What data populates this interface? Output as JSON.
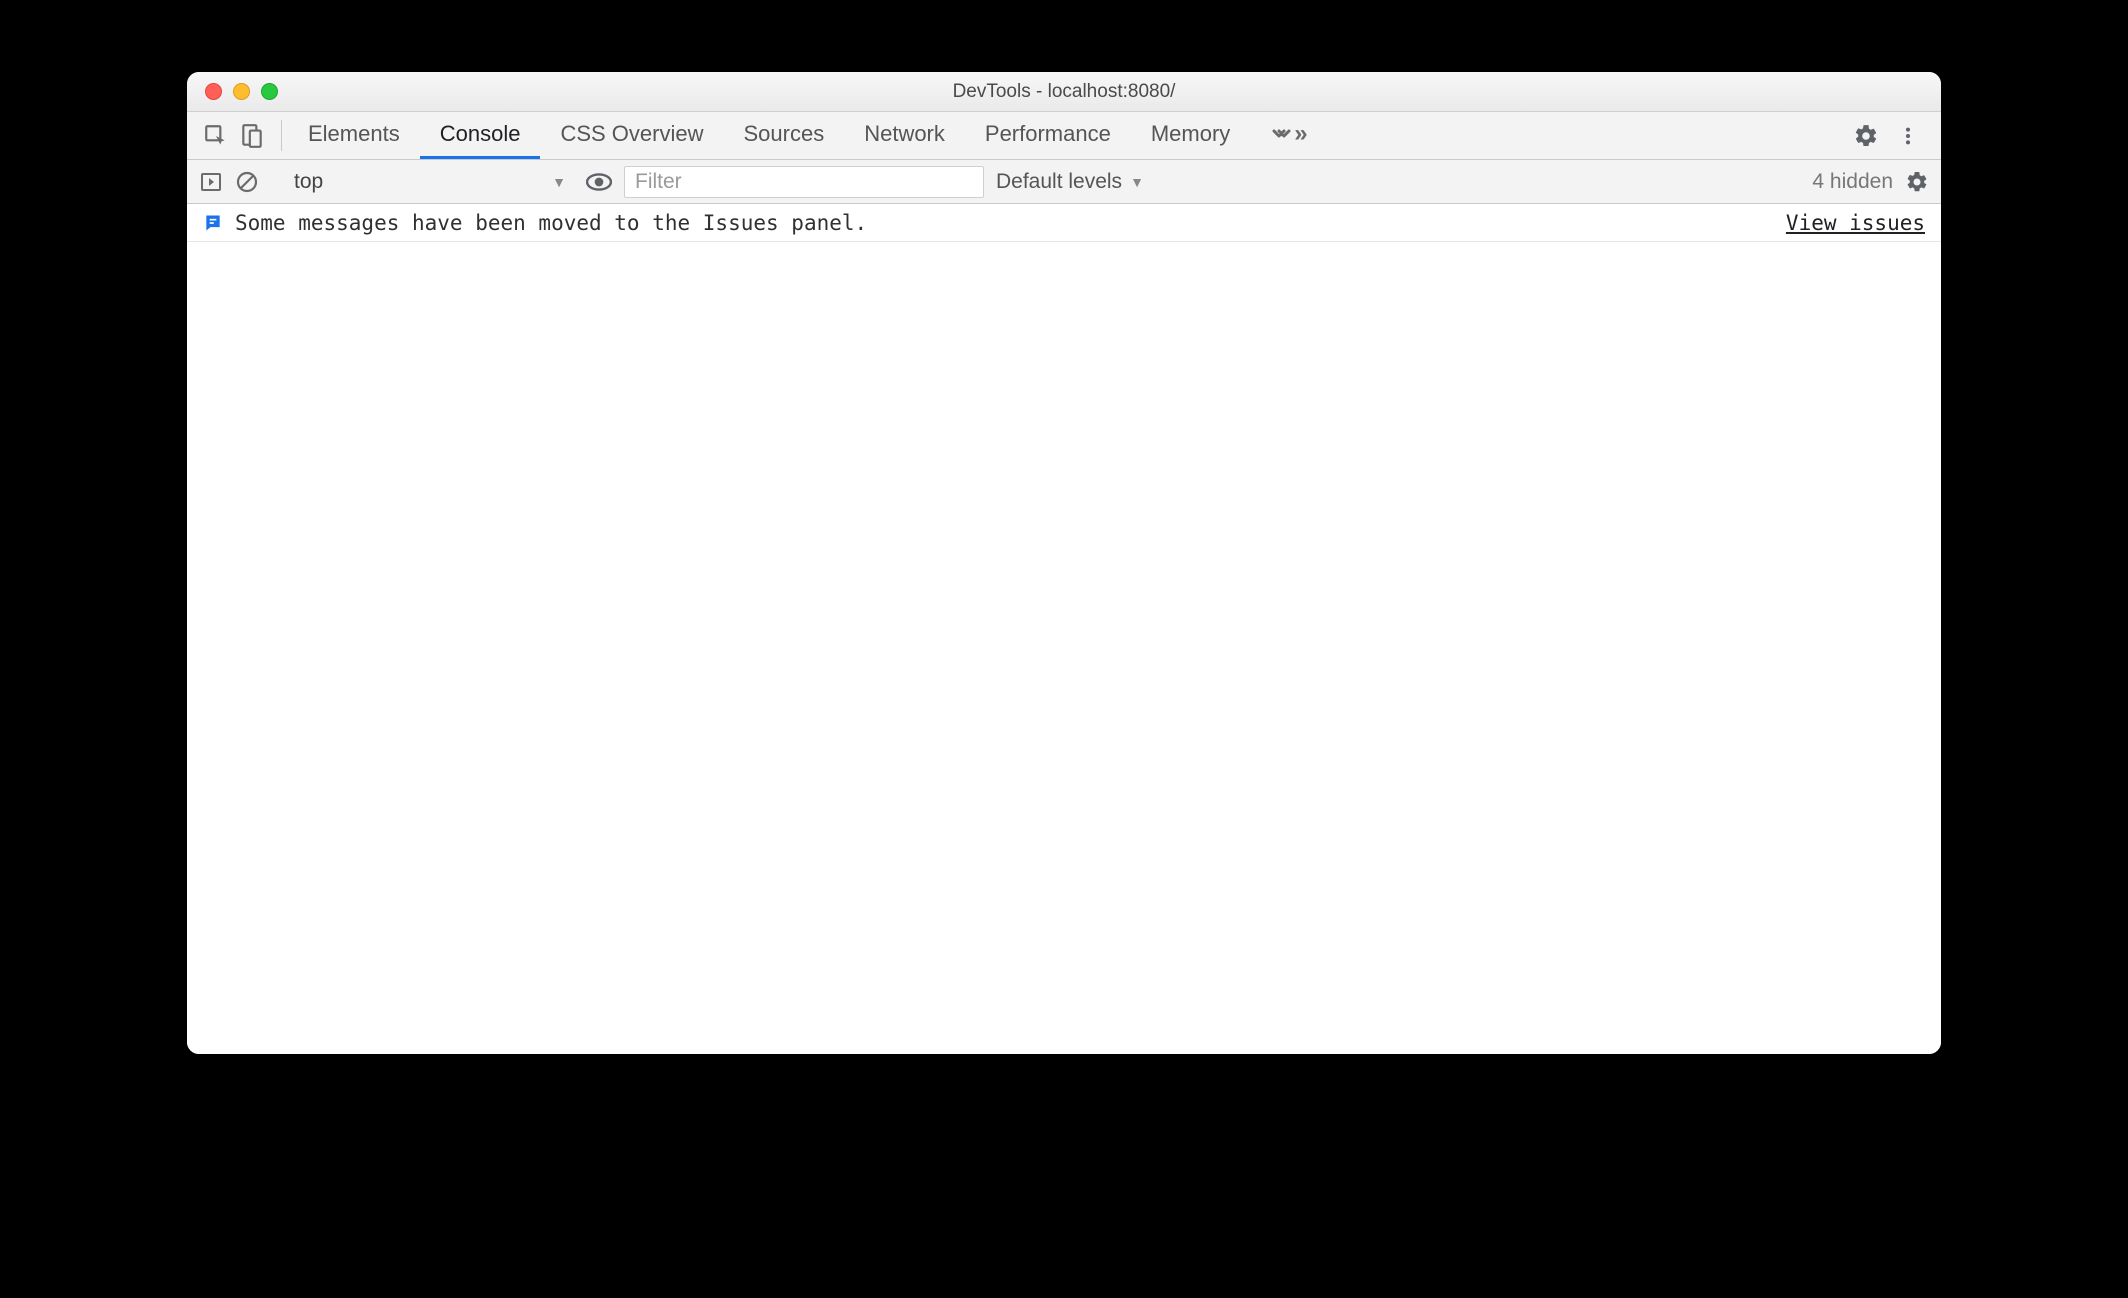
{
  "window": {
    "title": "DevTools - localhost:8080/"
  },
  "tabs": {
    "items": [
      {
        "label": "Elements",
        "active": false
      },
      {
        "label": "Console",
        "active": true
      },
      {
        "label": "CSS Overview",
        "active": false
      },
      {
        "label": "Sources",
        "active": false
      },
      {
        "label": "Network",
        "active": false
      },
      {
        "label": "Performance",
        "active": false
      },
      {
        "label": "Memory",
        "active": false
      }
    ]
  },
  "console_toolbar": {
    "context_label": "top",
    "filter_placeholder": "Filter",
    "levels_label": "Default levels",
    "hidden_label": "4 hidden"
  },
  "issues_message": {
    "text": "Some messages have been moved to the Issues panel.",
    "link_label": "View issues"
  }
}
